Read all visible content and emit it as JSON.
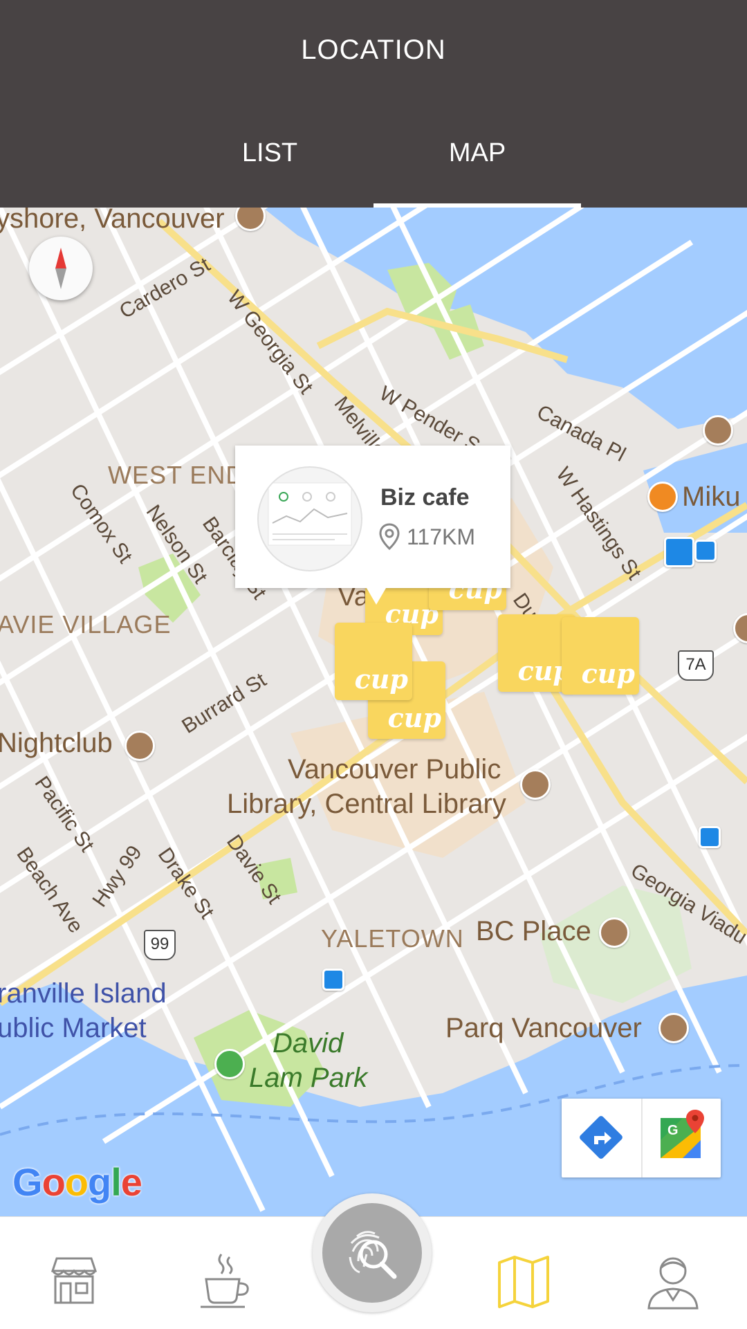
{
  "header": {
    "title": "LOCATION",
    "tabs": [
      {
        "label": "LIST",
        "active": false
      },
      {
        "label": "MAP",
        "active": true
      }
    ]
  },
  "map": {
    "labels": {
      "bayshore": "yshore, Vancouver",
      "west_end": "WEST END",
      "davie_village": "AVIE VILLAGE",
      "nightclub": "Nightclub",
      "library_1": "Vancouver Public",
      "library_2": "Library, Central Library",
      "yaletown": "YALETOWN",
      "bc_place": "BC Place",
      "parq": "Parq Vancouver",
      "granville_1": "ranville Island",
      "granville_2": "ublic Market",
      "david_lam_1": "David",
      "david_lam_2": "Lam Park",
      "miku": "Miku",
      "va": "Va",
      "canada_pl": "Canada Pl",
      "cardero": "Cardero St",
      "w_georgia": "W Georgia St",
      "melville": "Melville",
      "w_pender": "W Pender S",
      "w_hastings": "W Hastings St",
      "comox": "Comox St",
      "nelson": "Nelson St",
      "barclay": "Barclay St",
      "burrard": "Burrard St",
      "pacific": "Pacific St",
      "beach": "Beach Ave",
      "hwy99": "Hwy 99",
      "drake": "Drake St",
      "davie": "Davie St",
      "georgia_viaduct": "Georgia Viadu",
      "shield_99": "99",
      "shield_7a": "7A",
      "dunsmuir": "Du"
    },
    "marker_text": "cup",
    "popup": {
      "name": "Biz cafe",
      "distance": "117KM"
    },
    "google_logo": [
      "G",
      "o",
      "o",
      "g",
      "l",
      "e"
    ],
    "colors": {
      "water": "#a3ccff",
      "land": "#e9e6e3",
      "park": "#c8e6a0",
      "marker": "#f9d65e",
      "accent": "#f5d33c"
    },
    "buttons": {
      "directions": "directions-icon",
      "google_maps": "google-maps-icon"
    }
  },
  "nav": {
    "items": [
      "store-icon",
      "coffee-cup-icon",
      "fingerprint-search-icon",
      "map-icon",
      "profile-icon"
    ],
    "active": "map-icon"
  }
}
